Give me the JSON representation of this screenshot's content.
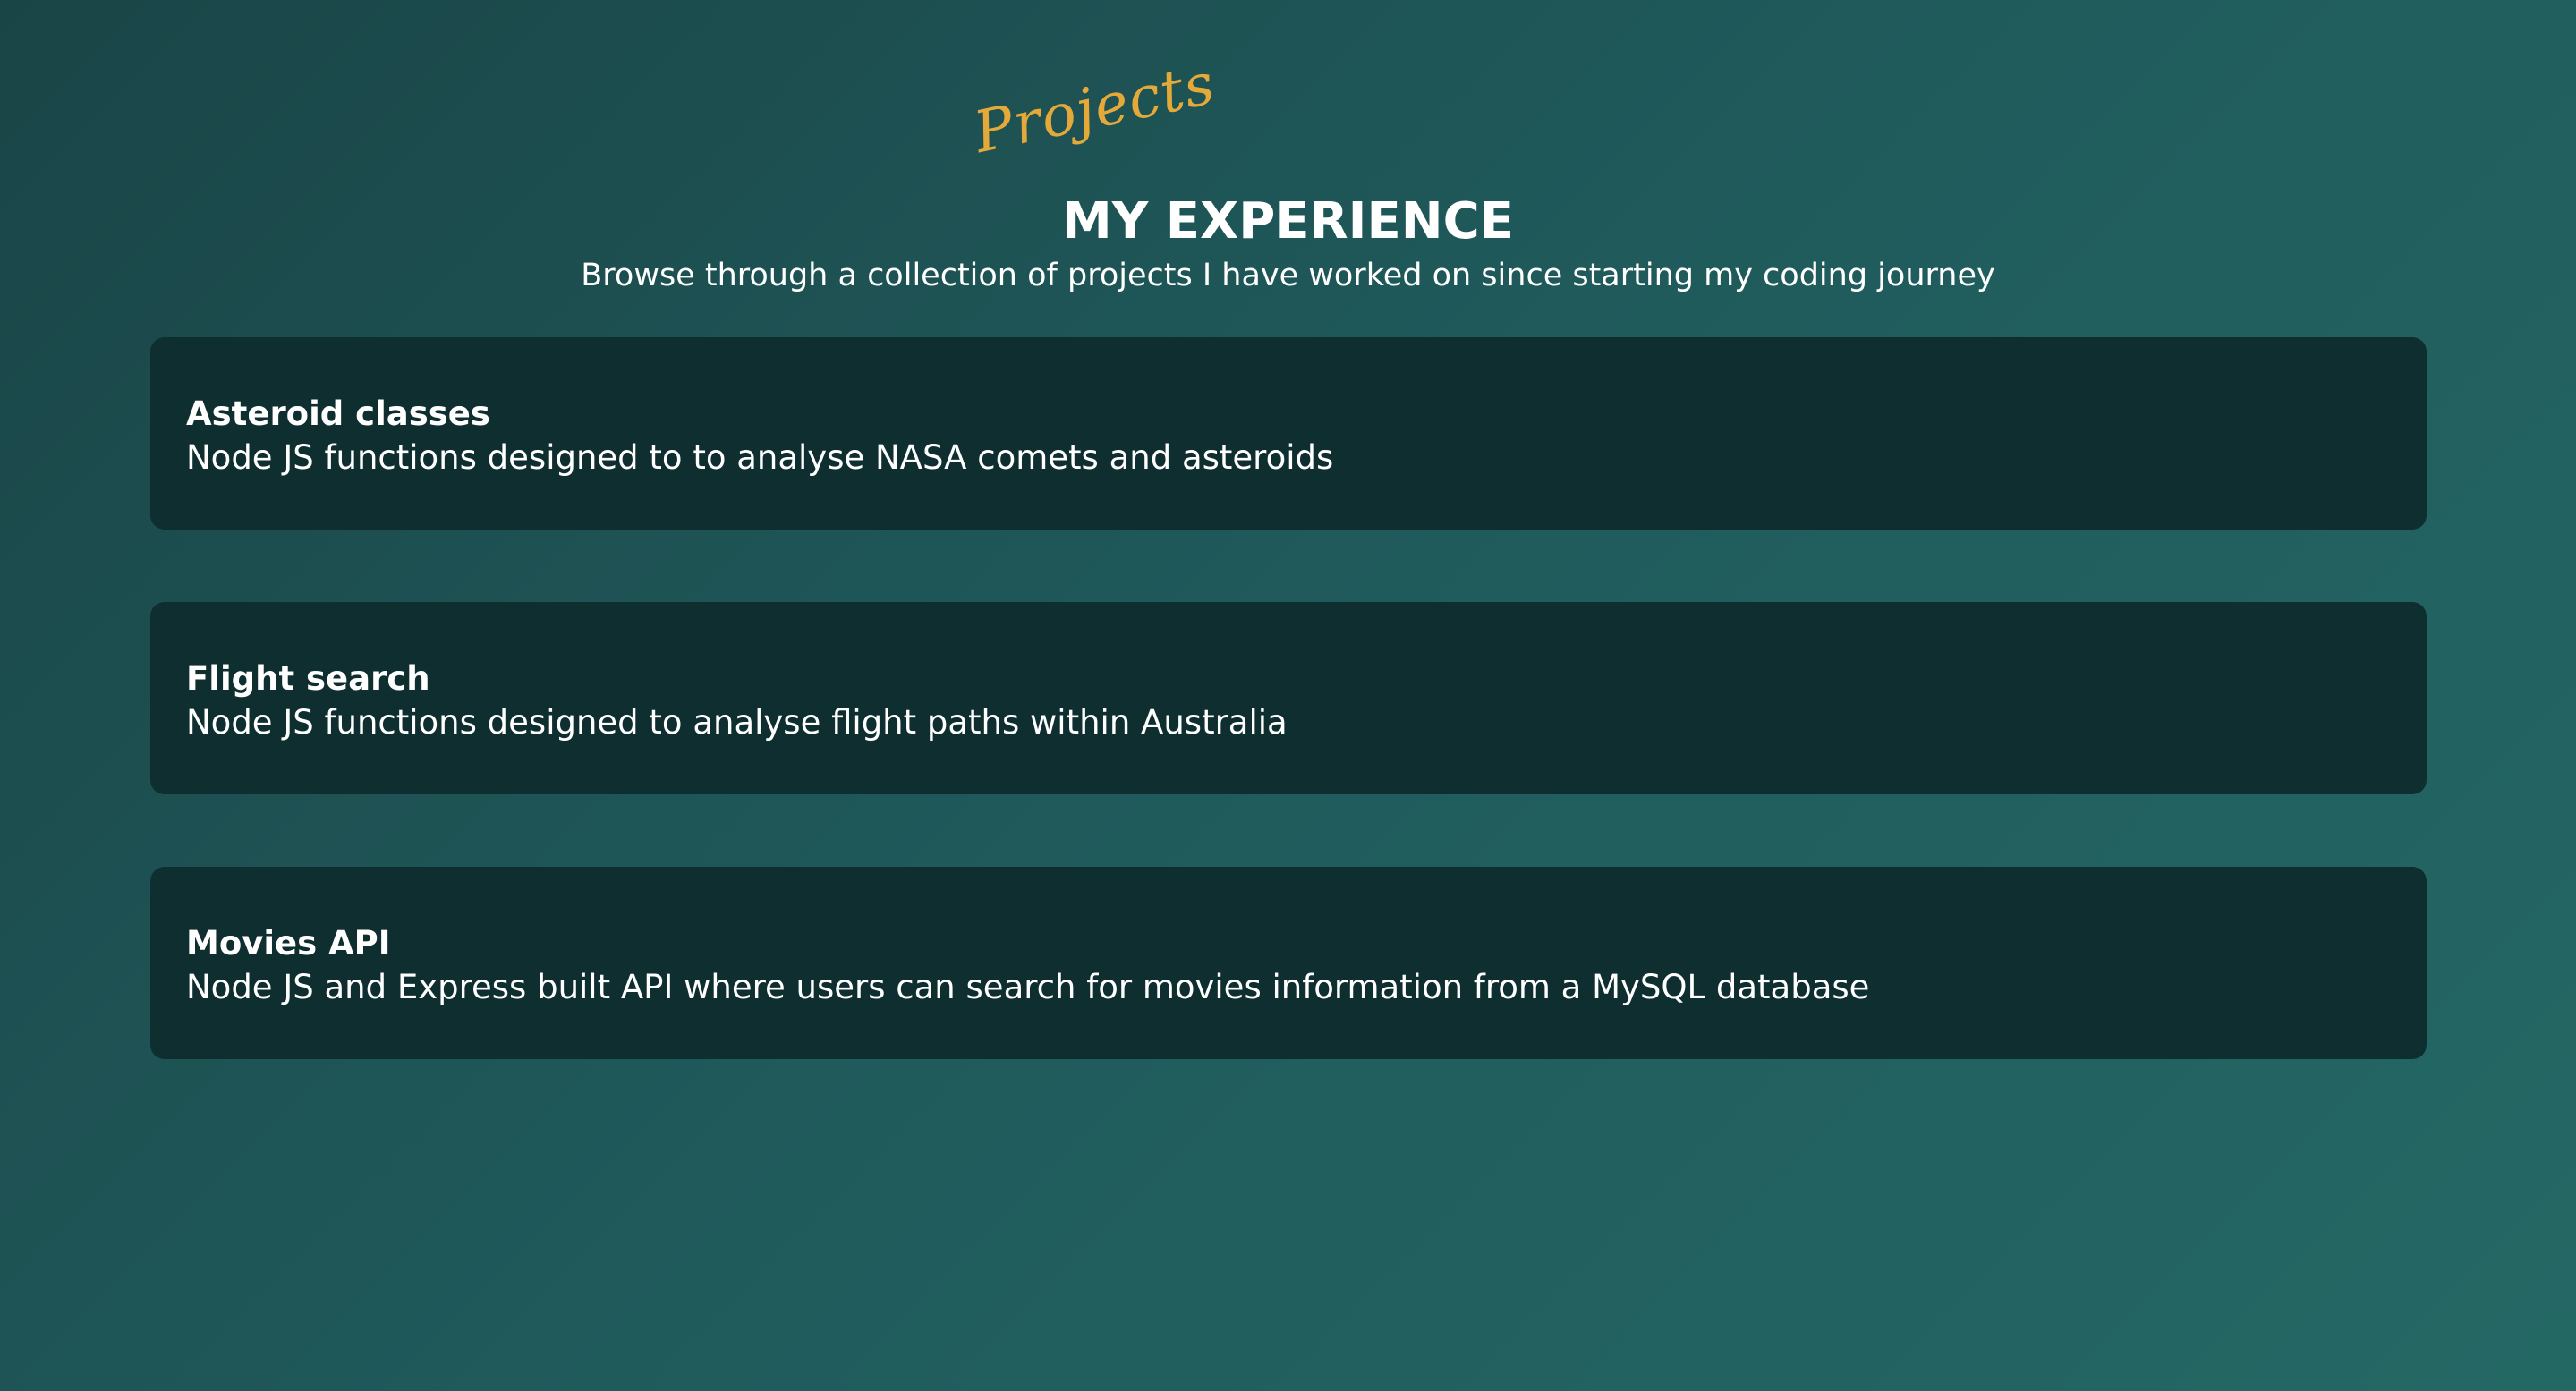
{
  "header": {
    "eyebrow": "Projects",
    "title": "MY EXPERIENCE",
    "subtitle": "Browse through a collection of projects I have worked on since starting my coding journey"
  },
  "projects": [
    {
      "title": "Asteroid classes",
      "description": "Node JS functions designed to to analyse NASA comets and asteroids"
    },
    {
      "title": "Flight search",
      "description": "Node JS functions designed to analyse flight paths within Australia"
    },
    {
      "title": "Movies API",
      "description": "Node JS and Express built API where users can search for movies information from a MySQL database"
    }
  ],
  "colors": {
    "background_start": "#1a4547",
    "background_end": "#246864",
    "card": "#0f2e2f",
    "accent": "#e5a93a",
    "text": "#ffffff"
  }
}
